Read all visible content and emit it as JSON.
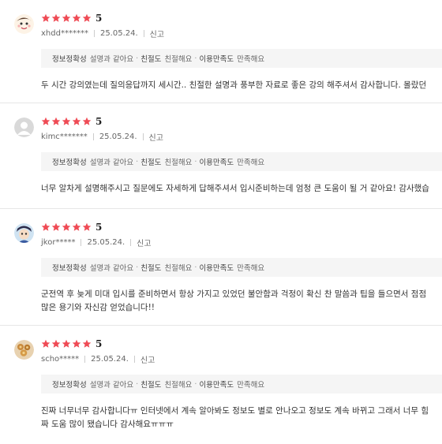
{
  "colors": {
    "star": "#ef4b55",
    "tag_bg": "#f5f5f5"
  },
  "reviews": [
    {
      "avatar": "cartoon-face-avatar",
      "score": "5",
      "user": "xhdd*******",
      "date": "25.05.24.",
      "report": "신고",
      "tags": [
        {
          "key": "정보정확성",
          "value": "설명과 같아요"
        },
        {
          "key": "친절도",
          "value": "친절해요"
        },
        {
          "key": "이용만족도",
          "value": "만족해요"
        }
      ],
      "text": [
        "두 시간 강의였는데 질의응답까지 세시간.. 친절한 설명과 풍부한 자료로 좋은 강의 해주셔서 감사합니다. 몰랐던"
      ]
    },
    {
      "avatar": "default-user-avatar",
      "score": "5",
      "user": "kimc*******",
      "date": "25.05.24.",
      "report": "신고",
      "tags": [
        {
          "key": "정보정확성",
          "value": "설명과 같아요"
        },
        {
          "key": "친절도",
          "value": "친절해요"
        },
        {
          "key": "이용만족도",
          "value": "만족해요"
        }
      ],
      "text": [
        "너무 알차게 설명해주시고 질문에도 자세하게 답해주셔서 입시준비하는데 엄청 큰 도움이 될 거 같아요! 감사했습"
      ]
    },
    {
      "avatar": "character-avatar",
      "score": "5",
      "user": "jkor*****",
      "date": "25.05.24.",
      "report": "신고",
      "tags": [
        {
          "key": "정보정확성",
          "value": "설명과 같아요"
        },
        {
          "key": "친절도",
          "value": "친절해요"
        },
        {
          "key": "이용만족도",
          "value": "만족해요"
        }
      ],
      "text": [
        "군전역 후 늦게 미대 입시를 준비하면서 항상 가지고 있었던 불안함과 걱정이 확신 찬 말씀과 팁을 들으면서 점점",
        "많은 용기와 자신감 얻었습니다!!"
      ]
    },
    {
      "avatar": "food-photo-avatar",
      "score": "5",
      "user": "scho*****",
      "date": "25.05.24.",
      "report": "신고",
      "tags": [
        {
          "key": "정보정확성",
          "value": "설명과 같아요"
        },
        {
          "key": "친절도",
          "value": "친절해요"
        },
        {
          "key": "이용만족도",
          "value": "만족해요"
        }
      ],
      "text": [
        "진짜 너무너무 감사합니다ㅠ 인터넷에서 계속 알아봐도 정보도 별로 안나오고 정보도 계속 바뀌고 그래서 너무 힘",
        "짜 도움 많이 됐습니다 감사해요ㅠㅠㅠ"
      ]
    }
  ]
}
